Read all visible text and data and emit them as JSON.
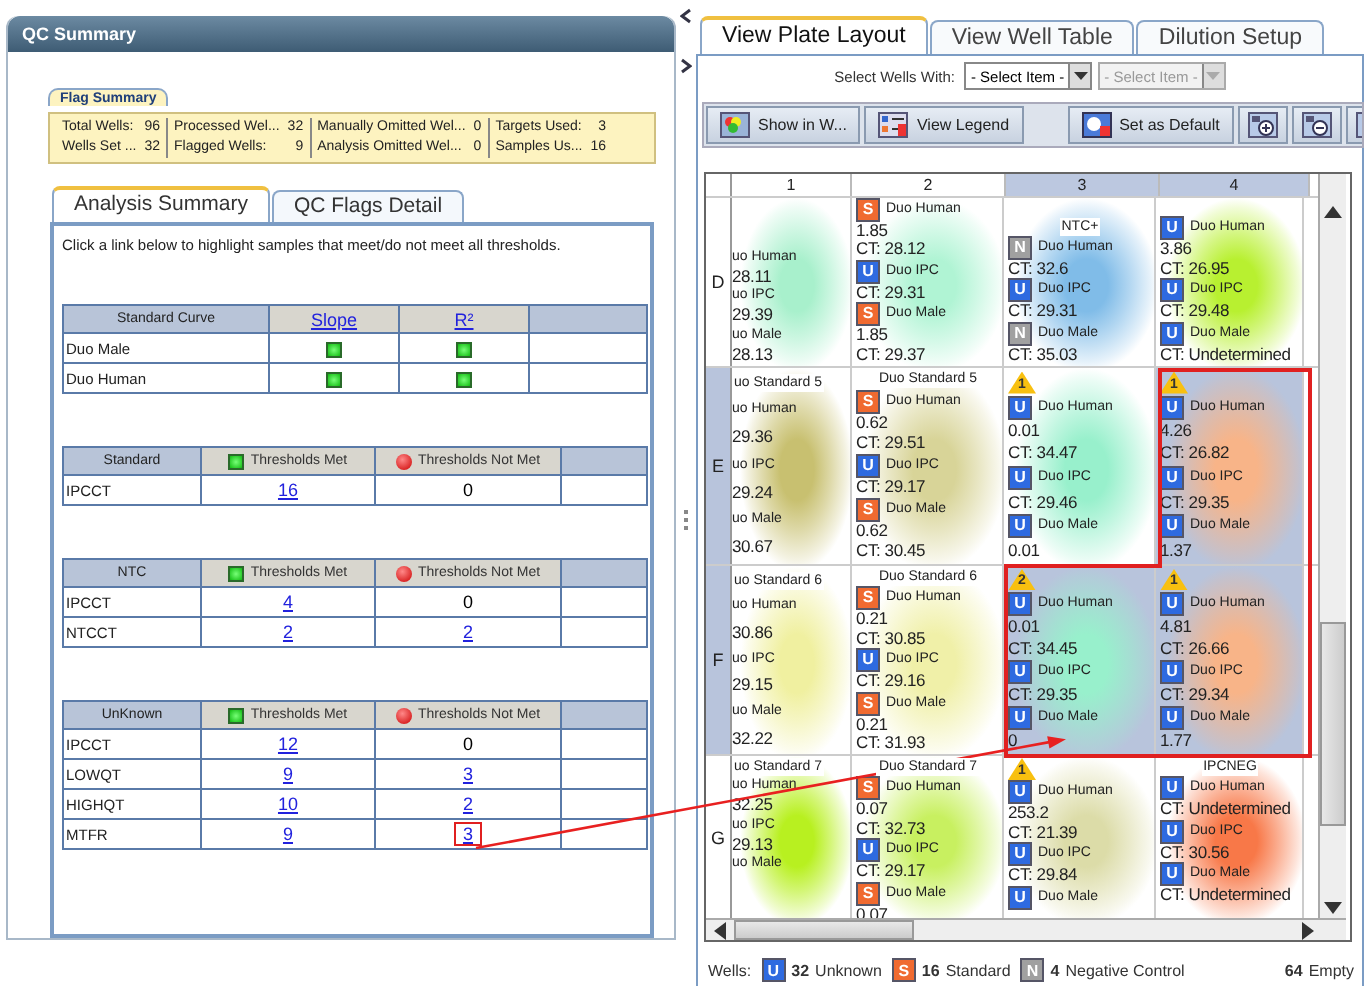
{
  "qc_panel": {
    "title": "QC Summary",
    "flag_summary": {
      "title": "Flag Summary",
      "columns": [
        [
          {
            "label": "Total Wells:",
            "value": "96"
          },
          {
            "label": "Wells Set ...",
            "value": "32"
          }
        ],
        [
          {
            "label": "Processed Wel...",
            "value": "32"
          },
          {
            "label": "Flagged Wells:",
            "value": "9"
          }
        ],
        [
          {
            "label": "Manually Omitted Wel...",
            "value": "0"
          },
          {
            "label": "Analysis Omitted Wel...",
            "value": "0"
          }
        ],
        [
          {
            "label": "Targets Used:",
            "value": "3"
          },
          {
            "label": "Samples Us...",
            "value": "16"
          }
        ]
      ]
    },
    "tabs": [
      {
        "label": "Analysis Summary",
        "selected": true
      },
      {
        "label": "QC Flags Detail",
        "selected": false
      }
    ],
    "instruction": "Click a link below to highlight samples that meet/do not meet all thresholds.",
    "standard_curve": {
      "columns": [
        "Standard Curve",
        "Slope",
        "R²"
      ],
      "rows": [
        {
          "name": "Duo Male",
          "checks": [
            {
              "passed": true
            },
            {
              "passed": true
            }
          ]
        },
        {
          "name": "Duo Human",
          "checks": [
            {
              "passed": true
            },
            {
              "passed": true
            }
          ]
        }
      ]
    },
    "threshold_tables": [
      {
        "name": "Standard",
        "met_label": "Thresholds Met",
        "not_met_label": "Thresholds Not Met",
        "rows": [
          {
            "name": "IPCCT",
            "met": {
              "text": "16",
              "link": true
            },
            "not_met": {
              "text": "0",
              "link": false
            }
          }
        ]
      },
      {
        "name": "NTC",
        "met_label": "Thresholds Met",
        "not_met_label": "Thresholds Not Met",
        "rows": [
          {
            "name": "IPCCT",
            "met": {
              "text": "4",
              "link": true
            },
            "not_met": {
              "text": "0",
              "link": false
            }
          },
          {
            "name": "NTCCT",
            "met": {
              "text": "2",
              "link": true
            },
            "not_met": {
              "text": "2",
              "link": true
            }
          }
        ]
      },
      {
        "name": "UnKnown",
        "met_label": "Thresholds Met",
        "not_met_label": "Thresholds Not Met",
        "rows": [
          {
            "name": "IPCCT",
            "met": {
              "text": "12",
              "link": true
            },
            "not_met": {
              "text": "0",
              "link": false
            }
          },
          {
            "name": "LOWQT",
            "met": {
              "text": "9",
              "link": true
            },
            "not_met": {
              "text": "3",
              "link": true
            }
          },
          {
            "name": "HIGHQT",
            "met": {
              "text": "10",
              "link": true
            },
            "not_met": {
              "text": "2",
              "link": true
            }
          },
          {
            "name": "MTFR",
            "met": {
              "text": "9",
              "link": true
            },
            "not_met": {
              "text": "3",
              "link": true,
              "highlighted": true
            }
          }
        ]
      }
    ]
  },
  "plate_panel": {
    "tabs": [
      {
        "label": "View Plate Layout",
        "selected": true
      },
      {
        "label": "View Well Table",
        "selected": false
      },
      {
        "label": "Dilution Setup",
        "selected": false
      }
    ],
    "select_label": "Select Wells With:",
    "selects": [
      {
        "value": "- Select Item -",
        "disabled": false
      },
      {
        "value": "- Select Item -",
        "disabled": true
      }
    ],
    "toolbar": [
      {
        "kind": "wells",
        "label": "Show in W..."
      },
      {
        "kind": "legend",
        "label": "View Legend"
      },
      {
        "kind": "default",
        "label": "Set as Default"
      },
      {
        "kind": "zoomin"
      },
      {
        "kind": "zoomout"
      },
      {
        "kind": "fit"
      }
    ],
    "columns": [
      {
        "label": "1",
        "selected": false
      },
      {
        "label": "2",
        "selected": false
      },
      {
        "label": "3",
        "selected": true
      },
      {
        "label": "4",
        "selected": true
      }
    ],
    "rows": [
      {
        "label": "D",
        "selected": false,
        "cells": [
          {
            "color": "#a8f0cc",
            "selected": false,
            "targets": [
              {
                "name": "uo Human",
                "values": [
                  "28.11"
                ]
              },
              {
                "name": "uo IPC",
                "values": [
                  "29.39"
                ]
              },
              {
                "name": "uo Male",
                "values": [
                  "28.13"
                ]
              }
            ]
          },
          {
            "color": "#b0f4d4",
            "selected": false,
            "targets": [
              {
                "kind": "standard",
                "badge": "S",
                "name": "Duo Human",
                "values": [
                  "1.85",
                  "CT: 28.12"
                ]
              },
              {
                "kind": "unknown",
                "badge": "U",
                "name": "Duo IPC",
                "values": [
                  "CT: 29.31"
                ]
              },
              {
                "kind": "standard",
                "badge": "S",
                "name": "Duo Male",
                "values": [
                  "1.85",
                  "CT: 29.37"
                ]
              }
            ]
          },
          {
            "color": "#80bce8",
            "selected": false,
            "header": "NTC+",
            "targets": [
              {
                "kind": "ntc",
                "badge": "N",
                "name": "Duo Human",
                "values": [
                  "CT: 32.6"
                ]
              },
              {
                "kind": "unknown",
                "badge": "U",
                "name": "Duo IPC",
                "values": [
                  "CT: 29.31"
                ]
              },
              {
                "kind": "ntc",
                "badge": "N",
                "name": "Duo Male",
                "values": [
                  "CT: 35.03"
                ]
              }
            ]
          },
          {
            "color": "#b8f030",
            "selected": false,
            "targets": [
              {
                "kind": "unknown",
                "badge": "U",
                "name": "Duo Human",
                "values": [
                  "3.86",
                  "CT: 26.95"
                ]
              },
              {
                "kind": "unknown",
                "badge": "U",
                "name": "Duo IPC",
                "values": [
                  "CT: 29.48"
                ]
              },
              {
                "kind": "unknown",
                "badge": "U",
                "name": "Duo Male",
                "values": [
                  "CT: Undetermined"
                ]
              }
            ]
          }
        ]
      },
      {
        "label": "E",
        "selected": true,
        "cells": [
          {
            "color": "#c8c070",
            "selected": false,
            "header": "uo Standard 5",
            "targets": [
              {
                "name": "uo Human",
                "values": [
                  "29.36"
                ]
              },
              {
                "name": "uo IPC",
                "values": [
                  "29.24"
                ]
              },
              {
                "name": "uo Male",
                "values": [
                  "30.67"
                ]
              }
            ]
          },
          {
            "color": "#d8d498",
            "selected": false,
            "header": "Duo Standard 5",
            "targets": [
              {
                "kind": "standard",
                "badge": "S",
                "name": "Duo Human",
                "values": [
                  "0.62",
                  "CT: 29.51"
                ]
              },
              {
                "kind": "unknown",
                "badge": "U",
                "name": "Duo IPC",
                "values": [
                  "CT: 29.17"
                ]
              },
              {
                "kind": "standard",
                "badge": "S",
                "name": "Duo Male",
                "values": [
                  "0.62",
                  "CT: 30.45"
                ]
              }
            ]
          },
          {
            "color": "#98f0cc",
            "selected": false,
            "flag": "1",
            "targets": [
              {
                "kind": "unknown",
                "badge": "U",
                "name": "Duo Human",
                "values": [
                  "0.01",
                  "CT: 34.47"
                ]
              },
              {
                "kind": "unknown",
                "badge": "U",
                "name": "Duo IPC",
                "values": [
                  "CT: 29.46"
                ]
              },
              {
                "kind": "unknown",
                "badge": "U",
                "name": "Duo Male",
                "values": [
                  "0.01"
                ]
              }
            ]
          },
          {
            "color": "#f8b488",
            "selected": true,
            "flag": "1",
            "targets": [
              {
                "kind": "unknown",
                "badge": "U",
                "name": "Duo Human",
                "values": [
                  "4.26",
                  "CT: 26.82"
                ]
              },
              {
                "kind": "unknown",
                "badge": "U",
                "name": "Duo IPC",
                "values": [
                  "CT: 29.35"
                ]
              },
              {
                "kind": "unknown",
                "badge": "U",
                "name": "Duo Male",
                "values": [
                  "1.37"
                ]
              }
            ]
          }
        ]
      },
      {
        "label": "F",
        "selected": true,
        "cells": [
          {
            "color": "#f0f0a0",
            "selected": false,
            "header": "uo Standard 6",
            "targets": [
              {
                "name": "uo Human",
                "values": [
                  "30.86"
                ]
              },
              {
                "name": "uo IPC",
                "values": [
                  "29.15"
                ]
              },
              {
                "name": "uo Male",
                "values": [
                  "32.22"
                ]
              }
            ]
          },
          {
            "color": "#f0f0a8",
            "selected": false,
            "header": "Duo Standard 6",
            "targets": [
              {
                "kind": "standard",
                "badge": "S",
                "name": "Duo Human",
                "values": [
                  "0.21",
                  "CT: 30.85"
                ]
              },
              {
                "kind": "unknown",
                "badge": "U",
                "name": "Duo IPC",
                "values": [
                  "CT: 29.16"
                ]
              },
              {
                "kind": "standard",
                "badge": "S",
                "name": "Duo Male",
                "values": [
                  "0.21",
                  "CT: 31.93"
                ]
              }
            ]
          },
          {
            "color": "#98f0cc",
            "selected": true,
            "flag": "2",
            "targets": [
              {
                "kind": "unknown",
                "badge": "U",
                "name": "Duo Human",
                "values": [
                  "0.01",
                  "CT: 34.45"
                ]
              },
              {
                "kind": "unknown",
                "badge": "U",
                "name": "Duo IPC",
                "values": [
                  "CT: 29.35"
                ]
              },
              {
                "kind": "unknown",
                "badge": "U",
                "name": "Duo Male",
                "values": [
                  "0"
                ]
              }
            ]
          },
          {
            "color": "#f8b488",
            "selected": true,
            "flag": "1",
            "targets": [
              {
                "kind": "unknown",
                "badge": "U",
                "name": "Duo Human",
                "values": [
                  "4.81",
                  "CT: 26.66"
                ]
              },
              {
                "kind": "unknown",
                "badge": "U",
                "name": "Duo IPC",
                "values": [
                  "CT: 29.34"
                ]
              },
              {
                "kind": "unknown",
                "badge": "U",
                "name": "Duo Male",
                "values": [
                  "1.77"
                ]
              }
            ]
          }
        ]
      },
      {
        "label": "G",
        "selected": false,
        "cells": [
          {
            "color": "#b8f020",
            "selected": false,
            "header": "uo Standard 7",
            "targets": [
              {
                "name": "uo Human",
                "values": [
                  "32.25"
                ]
              },
              {
                "name": "uo IPC",
                "values": [
                  "29.13"
                ]
              },
              {
                "name": "uo Male"
              }
            ]
          },
          {
            "color": "#c8f060",
            "selected": false,
            "header": "Duo Standard 7",
            "targets": [
              {
                "kind": "standard",
                "badge": "S",
                "name": "Duo Human",
                "values": [
                  "0.07",
                  "CT: 32.73"
                ]
              },
              {
                "kind": "unknown",
                "badge": "U",
                "name": "Duo IPC",
                "values": [
                  "CT: 29.17"
                ]
              },
              {
                "kind": "standard",
                "badge": "S",
                "name": "Duo Male",
                "values": [
                  "0.07"
                ]
              }
            ]
          },
          {
            "color": "#dcdca8",
            "selected": false,
            "flag": "1",
            "targets": [
              {
                "kind": "unknown",
                "badge": "U",
                "name": "Duo Human",
                "values": [
                  "253.2",
                  "CT: 21.39"
                ]
              },
              {
                "kind": "unknown",
                "badge": "U",
                "name": "Duo IPC",
                "values": [
                  "CT: 29.84"
                ]
              },
              {
                "kind": "unknown",
                "badge": "U",
                "name": "Duo Male"
              }
            ]
          },
          {
            "color": "#f87848",
            "selected": false,
            "header": "IPCNEG",
            "targets": [
              {
                "kind": "unknown",
                "badge": "U",
                "name": "Duo Human",
                "values": [
                  "CT: Undetermined"
                ]
              },
              {
                "kind": "unknown",
                "badge": "U",
                "name": "Duo IPC",
                "values": [
                  "CT: 30.56"
                ]
              },
              {
                "kind": "unknown",
                "badge": "U",
                "name": "Duo Male",
                "values": [
                  "CT: Undetermined"
                ]
              }
            ]
          }
        ]
      }
    ],
    "legend": {
      "label": "Wells:",
      "items": [
        {
          "kind": "unknown",
          "badge": "U",
          "count": "32",
          "name": "Unknown"
        },
        {
          "kind": "standard",
          "badge": "S",
          "count": "16",
          "name": "Standard"
        },
        {
          "kind": "ntc",
          "badge": "N",
          "count": "4",
          "name": "Negative Control"
        }
      ],
      "empty": {
        "count": "64",
        "name": "Empty"
      }
    }
  }
}
